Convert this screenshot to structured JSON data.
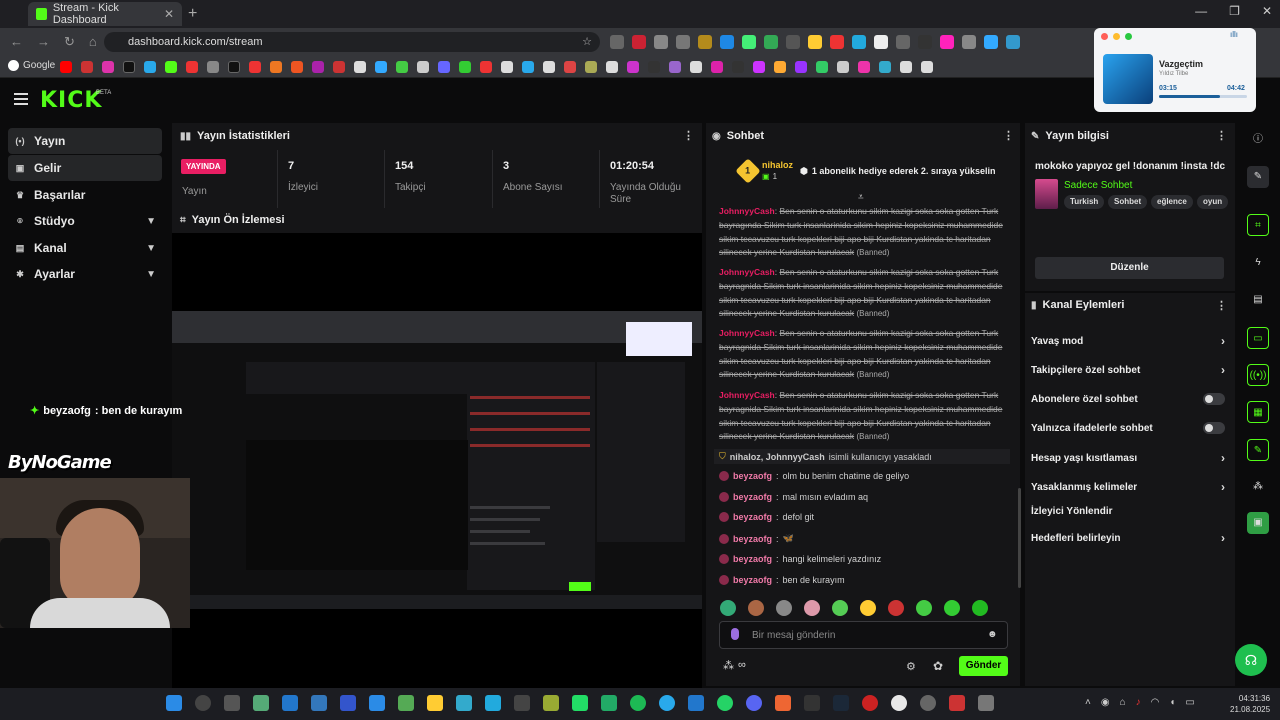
{
  "browser": {
    "tab_title": "Stream - Kick Dashboard",
    "url": "dashboard.kick.com/stream",
    "bookmark_google": "Google"
  },
  "app": {
    "logo": "KICK",
    "beta": "BETA"
  },
  "sidebar": {
    "items": [
      {
        "label": "Yayın",
        "icon": "broadcast-icon"
      },
      {
        "label": "Gelir",
        "icon": "dollar-icon"
      },
      {
        "label": "Başarılar",
        "icon": "trophy-icon"
      },
      {
        "label": "Stüdyo",
        "icon": "studio-icon"
      },
      {
        "label": "Kanal",
        "icon": "channel-icon"
      },
      {
        "label": "Ayarlar",
        "icon": "gear-icon"
      }
    ]
  },
  "stats_panel": {
    "title": "Yayın İstatistikleri",
    "live_badge": "YAYINDA",
    "stats": [
      {
        "value": "",
        "label": "Yayın"
      },
      {
        "value": "7",
        "label": "İzleyici"
      },
      {
        "value": "154",
        "label": "Takipçi"
      },
      {
        "value": "3",
        "label": "Abone Sayısı"
      },
      {
        "value": "01:20:54",
        "label": "Yayında Olduğu Süre"
      }
    ]
  },
  "preview_panel": {
    "title": "Yayın Ön İzlemesi",
    "overlay_user": "beyzaofg",
    "overlay_text": ": ben de kurayım",
    "watermark": "ByNoGame"
  },
  "chat": {
    "title": "Sohbet",
    "gift_user": "nihaloz",
    "gift_count": "1",
    "gift_rank": "1",
    "gift_text": "1 abonelik hediye ederek 2. sıraya yükselin",
    "banned_messages": [
      {
        "user": "JohnnyyCash",
        "text": "Ben senin o ataturkunu sikim kazigi soka soka gotten Turk bayragında Sikim turk insanlarinida sikim hepiniz kopeksiniz muhammedide sikim tecavuzcu turk kopekleri biji apo biji Kurdistan yakinda tc haritadan silinecek yerine Kurdistan kurulacak",
        "tag": "(Banned)"
      },
      {
        "user": "JohnnyyCash",
        "text": "Ben senin o ataturkunu sikim kazigi soka soka gotten Turk bayragnida Sikim turk insanlarinida sikim hepiniz kopeksiniz muhammedide sikim tecavuzcu turk kopekleri biji apo biji Kurdistan yakinda tc haritadan silinecek yerine Kurdistan kurulacak",
        "tag": "(Banned)"
      },
      {
        "user": "JohnnyyCash",
        "text": "Ben senin o ataturkunu sikim kazigi soka soka gotten Turk bayragnida Sikim turk insanlarinida sikim hepiniz kopeksiniz muhammedide sikim tecavuzcu turk kopekleri biji apo biji Kurdistan yakinda tc haritadan silinecek yerine Kurdistan kurulacak",
        "tag": "(Banned)"
      },
      {
        "user": "JohnnyyCash",
        "text": "Ben senin o ataturkunu sikim kazigi soka soka gotten Turk bayragnida Sikim turk insanlarinida sikim hepiniz kopeksiniz muhammedide sikim tecavuzcu turk kopekleri biji apo biji Kurdistan yakinda tc haritadan silinecek yerine Kurdistan kurulacak",
        "tag": "(Banned)"
      }
    ],
    "mod_action": {
      "users": "nihaloz, JohnnyyCash",
      "text": "isimli kullanıcıyı yasakladı"
    },
    "messages": [
      {
        "user": "beyzaofg",
        "text": "olm bu benim chatime de geliyo"
      },
      {
        "user": "beyzaofg",
        "text": "mal mısın evladım aq"
      },
      {
        "user": "beyzaofg",
        "text": "defol git"
      },
      {
        "user": "beyzaofg",
        "text": "🦋"
      },
      {
        "user": "beyzaofg",
        "text": "hangi kelimeleri yazdınız"
      },
      {
        "user": "beyzaofg",
        "text": "ben de kurayım"
      }
    ],
    "input_placeholder": "Bir mesaj gönderin",
    "send_label": "Gönder"
  },
  "stream_info": {
    "title": "Yayın bilgisi",
    "stream_title": "mokoko yapıyoz gel !donanım !insta !dc",
    "category": "Sadece Sohbet",
    "tags": [
      "Turkish",
      "Sohbet",
      "eğlence",
      "oyun"
    ],
    "edit_label": "Düzenle"
  },
  "channel_actions": {
    "title": "Kanal Eylemleri",
    "items": [
      {
        "label": "Yavaş mod",
        "kind": "arrow"
      },
      {
        "label": "Takipçilere özel sohbet",
        "kind": "arrow"
      },
      {
        "label": "Abonelere özel sohbet",
        "kind": "toggle"
      },
      {
        "label": "Yalnızca ifadelerle sohbet",
        "kind": "toggle"
      },
      {
        "label": "Hesap yaşı kısıtlaması",
        "kind": "arrow"
      },
      {
        "label": "Yasaklanmış kelimeler",
        "kind": "arrow"
      },
      {
        "label": "İzleyici Yönlendir",
        "kind": "none"
      },
      {
        "label": "Hedefleri belirleyin",
        "kind": "arrow"
      }
    ]
  },
  "spotify": {
    "title": "Vazgeçtim",
    "artist": "Yıldız Tilbe",
    "elapsed": "03:15",
    "total": "04:42",
    "progress": 0.69
  },
  "taskbar": {
    "time": "04:31:36",
    "date": "21.08.2025"
  },
  "colors": {
    "accent": "#53fc18",
    "live": "#e91e63",
    "panel": "#151517"
  }
}
